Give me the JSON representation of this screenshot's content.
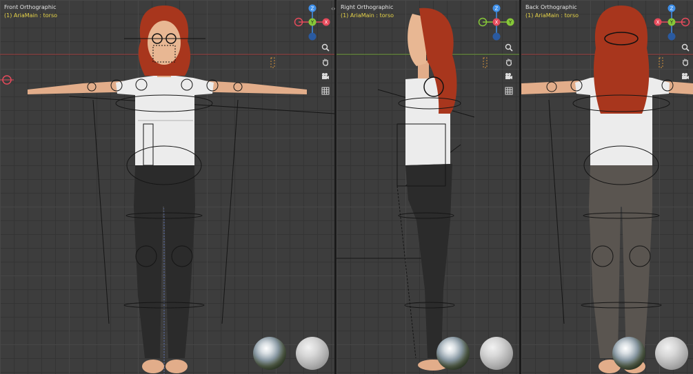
{
  "viewports": [
    {
      "id": "front",
      "title": "Front Orthographic",
      "subtitle": "(1) AriaMain : torso",
      "gizmo_labels": {
        "up": "Z",
        "center": "Y",
        "right": "X"
      }
    },
    {
      "id": "right",
      "title": "Right Orthographic",
      "subtitle": "(1) AriaMain : torso",
      "gizmo_labels": {
        "up": "Z",
        "center": "X",
        "right": "Y"
      }
    },
    {
      "id": "back",
      "title": "Back Orthographic",
      "subtitle": "(1) AriaMain : torso",
      "gizmo_labels": {
        "up": "Z",
        "center": "Y",
        "right": "X"
      }
    }
  ],
  "join_arrows": "‹›",
  "nav_tools": [
    "zoom-icon",
    "pan-hand-icon",
    "camera-icon",
    "grid-icon"
  ],
  "colors": {
    "axis_x": "#e74a5b",
    "axis_y": "#86c838",
    "axis_z": "#3f8fe8",
    "subtitle": "#e8d54a",
    "shirt": "#ececec",
    "pants_front": "#2b2b2b",
    "pants_back": "#5a5550",
    "hair": "#a8361d",
    "skin": "#e8b793"
  }
}
